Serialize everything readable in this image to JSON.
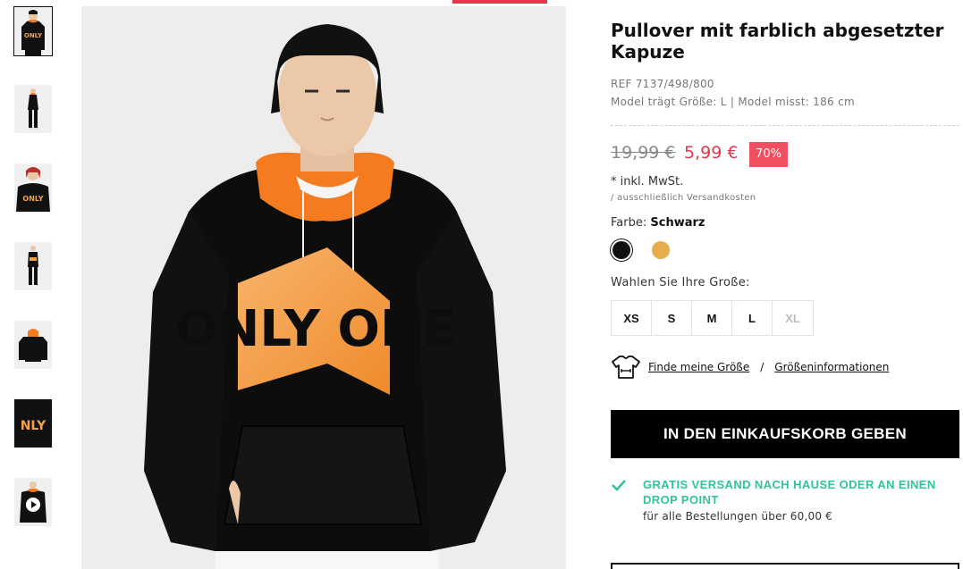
{
  "product": {
    "title": "Pullover mit farblich abgesetzter Kapuze",
    "ref": "REF 7137/498/800",
    "model_info": "Model trägt Größe: L | Model misst: 186 cm",
    "old_price": "19,99 €",
    "new_price": "5,99 €",
    "discount": "70%",
    "vat": "* inkl. MwSt.",
    "shipping_note": "/ ausschließlich Versandkosten",
    "color_label": "Farbe:",
    "color_value": "Schwarz",
    "colors": [
      {
        "name": "Schwarz",
        "hex": "#111111",
        "selected": true
      },
      {
        "name": "Senf",
        "hex": "#e7ad4a",
        "selected": false
      }
    ],
    "size_label": "Wahlen Sie Ihre Große:",
    "sizes": [
      {
        "label": "XS",
        "available": true
      },
      {
        "label": "S",
        "available": true
      },
      {
        "label": "M",
        "available": true
      },
      {
        "label": "L",
        "available": true
      },
      {
        "label": "XL",
        "available": false
      }
    ],
    "find_size": "Finde meine Größe",
    "separator": "/",
    "size_info": "Größeninformationen",
    "cart_button": "IN DEN EINKAUFSKORB GEBEN",
    "free_shipping": "GRATIS VERSAND NACH HAUSE ODER AN EINEN DROP POINT",
    "free_shipping_sub": "für alle Bestellungen über 60,00 €",
    "print_text": "ONLY ONE"
  },
  "colors": {
    "accent_red": "#e8334a",
    "badge_red": "#ef4f5f",
    "success_green": "#2fc49a",
    "hoodie_black": "#0d0d0d",
    "hood_orange": "#f47b20"
  },
  "thumbnails": [
    {
      "icon": "hoodie-front-thumb",
      "active": true
    },
    {
      "icon": "full-body-thumb",
      "active": false
    },
    {
      "icon": "print-closeup-thumb",
      "active": false
    },
    {
      "icon": "full-body-side-thumb",
      "active": false
    },
    {
      "icon": "hoodie-back-thumb",
      "active": false
    },
    {
      "icon": "print-detail-thumb",
      "active": false
    },
    {
      "icon": "video-thumb",
      "active": false
    }
  ]
}
